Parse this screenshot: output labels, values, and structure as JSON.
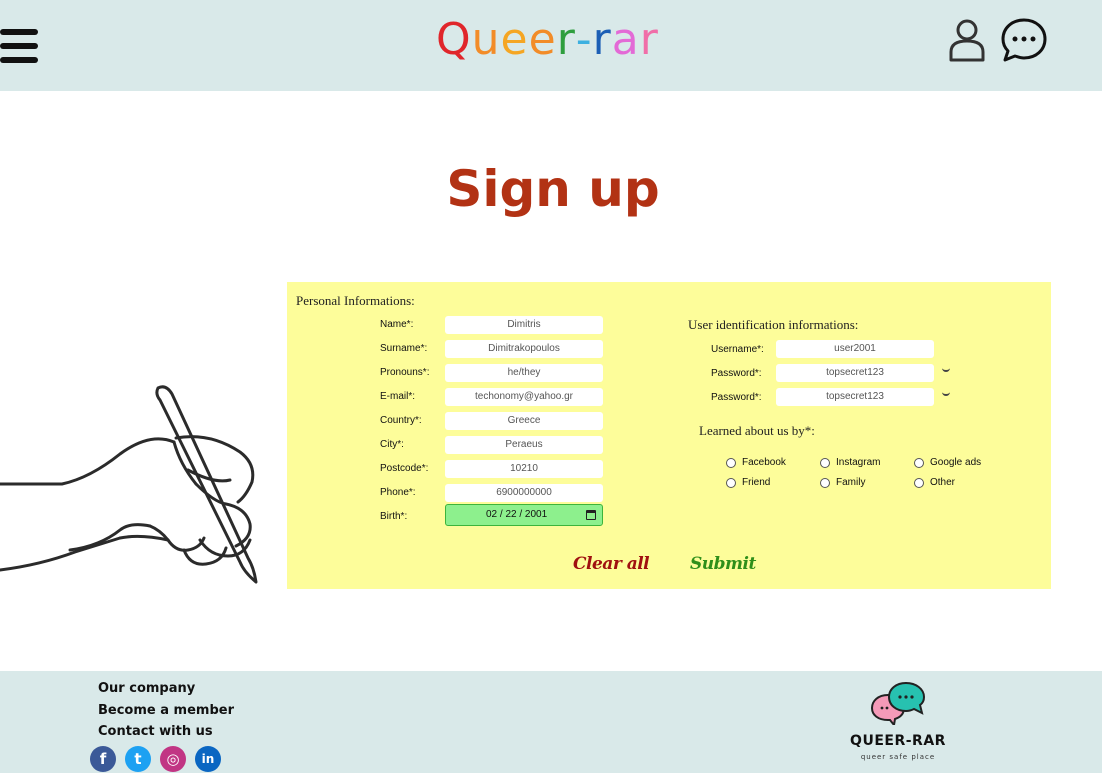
{
  "header": {
    "logo_letters": [
      {
        "char": "Q",
        "color": "#e0262b"
      },
      {
        "char": "u",
        "color": "#f28c28"
      },
      {
        "char": "e",
        "color": "#f5a623"
      },
      {
        "char": "e",
        "color": "#f28c28"
      },
      {
        "char": "r",
        "color": "#2e9e3e"
      },
      {
        "char": "-",
        "color": "#3cb0e0"
      },
      {
        "char": "r",
        "color": "#1c5fb5"
      },
      {
        "char": "a",
        "color": "#e36ad6"
      },
      {
        "char": "r",
        "color": "#f06ea8"
      }
    ],
    "icons": [
      "menu-icon",
      "user-icon",
      "chat-icon"
    ]
  },
  "page_title": "Sign up",
  "form": {
    "personal_title": "Personal Informations:",
    "personal_fields": [
      {
        "label": "Name*:",
        "value": "Dimitris"
      },
      {
        "label": "Surname*:",
        "value": "Dimitrakopoulos"
      },
      {
        "label": "Pronouns*:",
        "value": "he/they"
      },
      {
        "label": "E-mail*:",
        "value": "techonomy@yahoo.gr"
      },
      {
        "label": "Country*:",
        "value": "Greece"
      },
      {
        "label": "City*:",
        "value": "Peraeus"
      },
      {
        "label": "Postcode*:",
        "value": "10210"
      },
      {
        "label": "Phone*:",
        "value": "6900000000"
      }
    ],
    "birth_label": "Birth*:",
    "birth_value": "02 / 22 / 2001",
    "user_title": "User identification informations:",
    "user_fields": [
      {
        "label": "Username*:",
        "value": "user2001"
      },
      {
        "label": "Password*:",
        "value": "topsecret123"
      },
      {
        "label": "Password*:",
        "value": "topsecret123"
      }
    ],
    "learned_title": "Learned about us by*:",
    "learned_options": [
      "Facebook",
      "Instagram",
      "Google ads",
      "Friend",
      "Family",
      "Other"
    ],
    "clear_label": "Clear all",
    "submit_label": "Submit"
  },
  "footer": {
    "links": [
      "Our company",
      "Become a member",
      "Contact with us"
    ],
    "social": [
      {
        "name": "facebook",
        "glyph": "f",
        "color": "#3b5998"
      },
      {
        "name": "twitter",
        "glyph": "t",
        "color": "#1da1f2"
      },
      {
        "name": "instagram",
        "glyph": "◎",
        "color": "#c13584"
      },
      {
        "name": "linkedin",
        "glyph": "in",
        "color": "#0a66c2"
      }
    ],
    "brand": "QUEER-RAR",
    "tagline": "queer safe place"
  },
  "colors": {
    "header_bg": "#d9e9e9",
    "title": "#b23214",
    "panel_bg": "#fdfd9a",
    "clear": "#a01010",
    "submit": "#2f8f1a",
    "birth_bg": "#8df08d"
  }
}
